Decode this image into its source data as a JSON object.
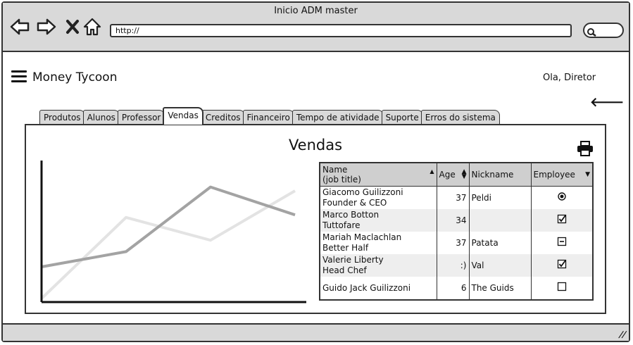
{
  "window": {
    "title": "Inicio ADM master",
    "url": "http://"
  },
  "app": {
    "title": "Money Tycoon",
    "greeting": "Ola, Diretor"
  },
  "tabs": [
    {
      "label": "Produtos"
    },
    {
      "label": "Alunos"
    },
    {
      "label": "Professor"
    },
    {
      "label": "Vendas",
      "active": true
    },
    {
      "label": "Creditos"
    },
    {
      "label": "Financeiro"
    },
    {
      "label": "Tempo de atividade"
    },
    {
      "label": "Suporte"
    },
    {
      "label": "Erros do sistema"
    }
  ],
  "panel": {
    "title": "Vendas"
  },
  "chart_data": {
    "type": "line",
    "title": "",
    "xlabel": "",
    "ylabel": "",
    "x": [
      0,
      1,
      2,
      3
    ],
    "series": [
      {
        "values": [
          0.25,
          0.37,
          0.88,
          0.66
        ],
        "color": "#a3a3a3"
      },
      {
        "values": [
          0.0,
          0.64,
          0.46,
          0.85
        ],
        "color": "#e3e3e3"
      }
    ]
  },
  "table": {
    "headers": {
      "name_line1": "Name",
      "name_line2": "(job title)",
      "age": "Age",
      "nickname": "Nickname",
      "employee": "Employee"
    },
    "rows": [
      {
        "name": "Giacomo Guilizzoni",
        "title": "Founder & CEO",
        "age": "37",
        "nickname": "Peldi",
        "employee": "radio-selected"
      },
      {
        "name": "Marco Botton",
        "title": "Tuttofare",
        "age": "34",
        "nickname": "",
        "employee": "checked"
      },
      {
        "name": "Mariah Maclachlan",
        "title": "Better Half",
        "age": "37",
        "nickname": "Patata",
        "employee": "indeterminate"
      },
      {
        "name": "Valerie Liberty",
        "title": "Head Chef",
        "age": ":)",
        "nickname": "Val",
        "employee": "checked"
      },
      {
        "name": "Guido Jack Guilizzoni",
        "title": "",
        "age": "6",
        "nickname": "The Guids",
        "employee": "unchecked"
      }
    ]
  },
  "icons": {
    "back": "arrow-left-icon",
    "forward": "arrow-right-icon",
    "stop": "close-icon",
    "home": "home-icon",
    "search": "search-icon",
    "menu": "hamburger-menu-icon",
    "print": "printer-icon",
    "return": "back-arrow-icon"
  }
}
